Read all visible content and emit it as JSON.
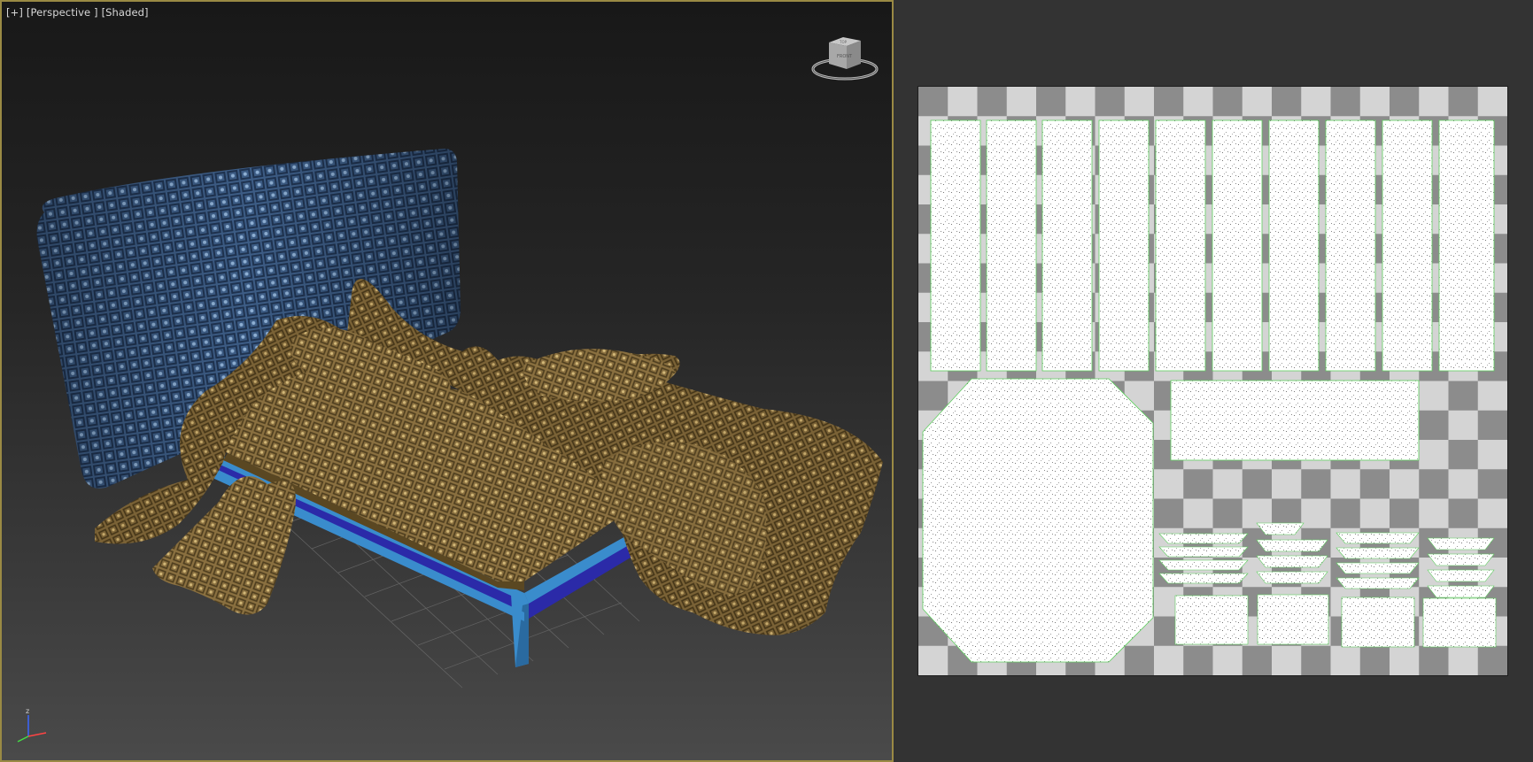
{
  "viewport": {
    "labels": [
      "[+]",
      "[Perspective ]",
      "[Shaded]"
    ]
  },
  "viewcube": {
    "face_labels": [
      "TOP",
      "FRONT"
    ]
  },
  "axis": {
    "z": "z",
    "x": "x",
    "y": "y"
  },
  "colors": {
    "viewport_border": "#9a8a44",
    "headboard": "#3d5d86",
    "sheet": "#8a7040",
    "frame_light": "#3a8ccc",
    "frame_dark": "#2b2aa8",
    "checker_dark": "#8c8c8c",
    "checker_light": "#d4d4d4",
    "uv_island": "#ffffff",
    "uv_edge": "#5fcf5f"
  }
}
